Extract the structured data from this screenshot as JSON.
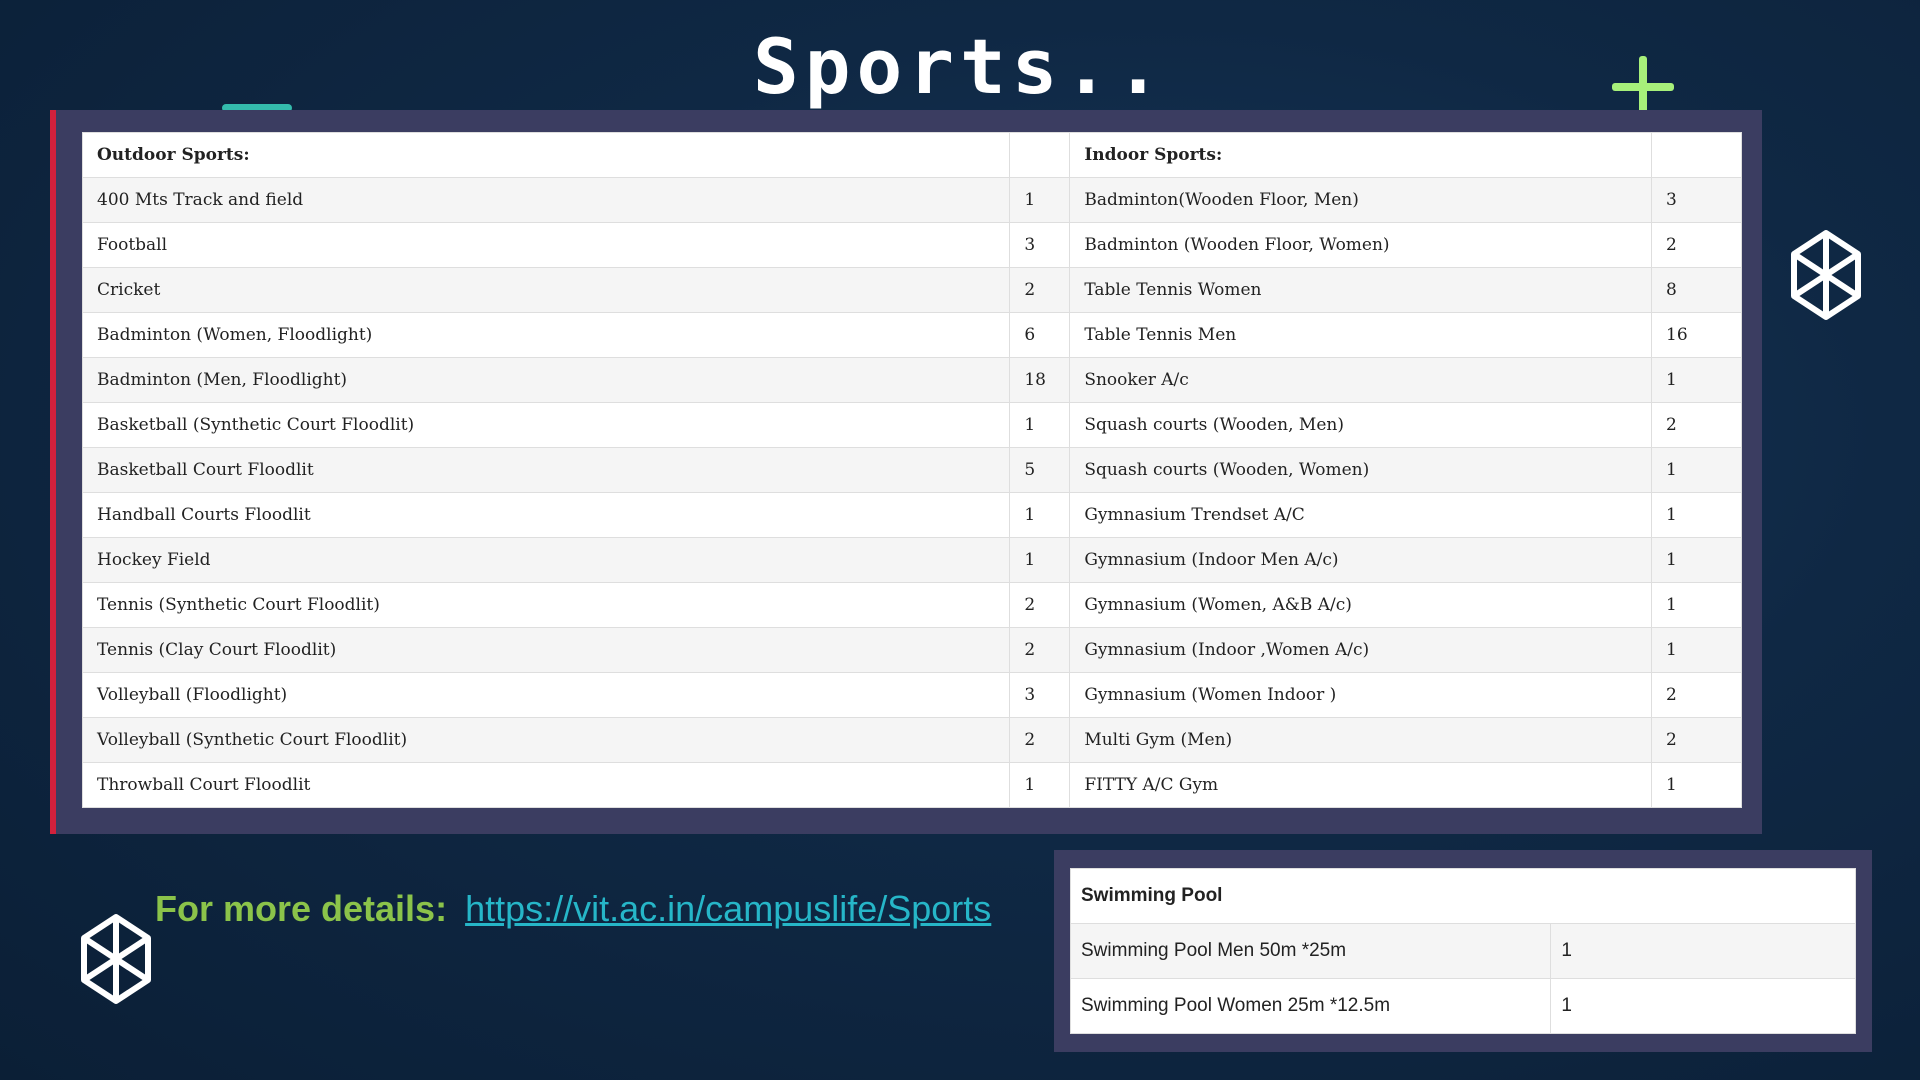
{
  "title": "Sports..",
  "main_table": {
    "outdoor_header": "Outdoor Sports:",
    "indoor_header": "Indoor Sports:",
    "rows": [
      {
        "outdoor": "400 Mts Track and field",
        "outdoor_count": "1",
        "indoor": "Badminton(Wooden Floor, Men)",
        "indoor_count": "3"
      },
      {
        "outdoor": "Football",
        "outdoor_count": "3",
        "indoor": "Badminton  (Wooden Floor,  Women)",
        "indoor_count": "2"
      },
      {
        "outdoor": "Cricket",
        "outdoor_count": "2",
        "indoor": "Table Tennis Women",
        "indoor_count": "8"
      },
      {
        "outdoor": "Badminton (Women, Floodlight)",
        "outdoor_count": "6",
        "indoor": "Table Tennis Men",
        "indoor_count": "16"
      },
      {
        "outdoor": "Badminton (Men, Floodlight)",
        "outdoor_count": "18",
        "indoor": "Snooker A/c",
        "indoor_count": "1"
      },
      {
        "outdoor": "Basketball (Synthetic Court Floodlit)",
        "outdoor_count": "1",
        "indoor": "Squash courts (Wooden,  Men)",
        "indoor_count": "2"
      },
      {
        "outdoor": "Basketball Court Floodlit",
        "outdoor_count": "5",
        "indoor": "Squash courts (Wooden,  Women)",
        "indoor_count": "1"
      },
      {
        "outdoor": "Handball Courts Floodlit",
        "outdoor_count": "1",
        "indoor": "Gymnasium Trendset A/C",
        "indoor_count": "1"
      },
      {
        "outdoor": "Hockey Field",
        "outdoor_count": "1",
        "indoor": "Gymnasium (Indoor Men A/c)",
        "indoor_count": "1"
      },
      {
        "outdoor": "Tennis (Synthetic Court Floodlit)",
        "outdoor_count": "2",
        "indoor": "Gymnasium (Women, A&B A/c)",
        "indoor_count": "1"
      },
      {
        "outdoor": "Tennis (Clay Court Floodlit)",
        "outdoor_count": "2",
        "indoor": "Gymnasium (Indoor ,Women A/c)",
        "indoor_count": "1"
      },
      {
        "outdoor": "Volleyball (Floodlight)",
        "outdoor_count": "3",
        "indoor": "Gymnasium (Women Indoor )",
        "indoor_count": "2"
      },
      {
        "outdoor": "Volleyball (Synthetic  Court Floodlit)",
        "outdoor_count": "2",
        "indoor": "Multi Gym (Men)",
        "indoor_count": "2"
      },
      {
        "outdoor": "Throwball Court Floodlit",
        "outdoor_count": "1",
        "indoor": "FITTY A/C Gym",
        "indoor_count": "1"
      }
    ]
  },
  "details": {
    "label": "For more details:",
    "link_text": "https://vit.ac.in/campuslife/Sports"
  },
  "swim_table": {
    "header": "Swimming Pool",
    "rows": [
      {
        "name": "Swimming Pool Men 50m *25m",
        "count": "1"
      },
      {
        "name": "Swimming Pool Women 25m *12.5m",
        "count": "1"
      }
    ]
  },
  "colors": {
    "accent_green": "#8bc34a",
    "link_cyan": "#26b6c8",
    "panel": "#3b3d61",
    "accent_red": "#d2213c"
  },
  "icons": [
    "plus-icon",
    "codepen-gem-icon"
  ]
}
